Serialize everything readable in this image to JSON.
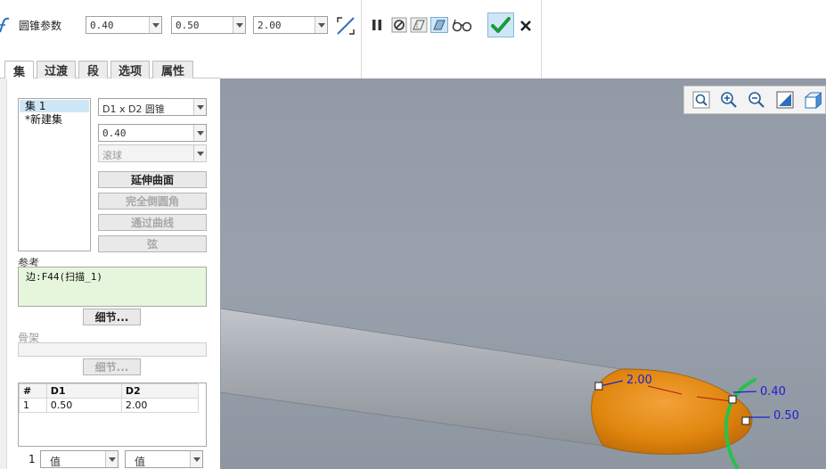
{
  "dashboard": {
    "label": "圆锥参数",
    "param1": "0.40",
    "param2": "0.50",
    "param3": "2.00",
    "colors": {
      "ok_accent": "#1a9a3a",
      "close": "#222222"
    }
  },
  "tabs": [
    "集",
    "过渡",
    "段",
    "选项",
    "属性"
  ],
  "sets_panel": {
    "sets": [
      "集 1",
      "*新建集"
    ],
    "shape_type": "D1 x D2 圆锥",
    "rho_value": "0.40",
    "method": "滚球",
    "buttons": {
      "extend_surfaces": "延伸曲面",
      "full_round": "完全倒圆角",
      "through_curve": "通过曲线",
      "chord": "弦"
    }
  },
  "references": {
    "label": "参考",
    "items": [
      "边:F44(扫描_1)"
    ],
    "details_button": "细节..."
  },
  "skeleton": {
    "label": "骨架",
    "details_button": "细节..."
  },
  "dimension_table": {
    "columns": [
      "#",
      "D1",
      "D2"
    ],
    "rows": [
      [
        "1",
        "0.50",
        "2.00"
      ]
    ],
    "footer_index": "1",
    "footer_sel1": "值",
    "footer_sel2": "值"
  },
  "viewport": {
    "colors": {
      "background": "#959da8",
      "cylinder": "#a9adb3",
      "round": "#e48a12",
      "handle": "#27c24c",
      "dims": "#1f1fd0"
    },
    "dimensions": [
      "2.00",
      "0.40",
      "0.50"
    ]
  },
  "view_tools": [
    "zoom-window-icon",
    "zoom-in-icon",
    "zoom-out-icon",
    "refit-icon",
    "view-orient-icon"
  ]
}
